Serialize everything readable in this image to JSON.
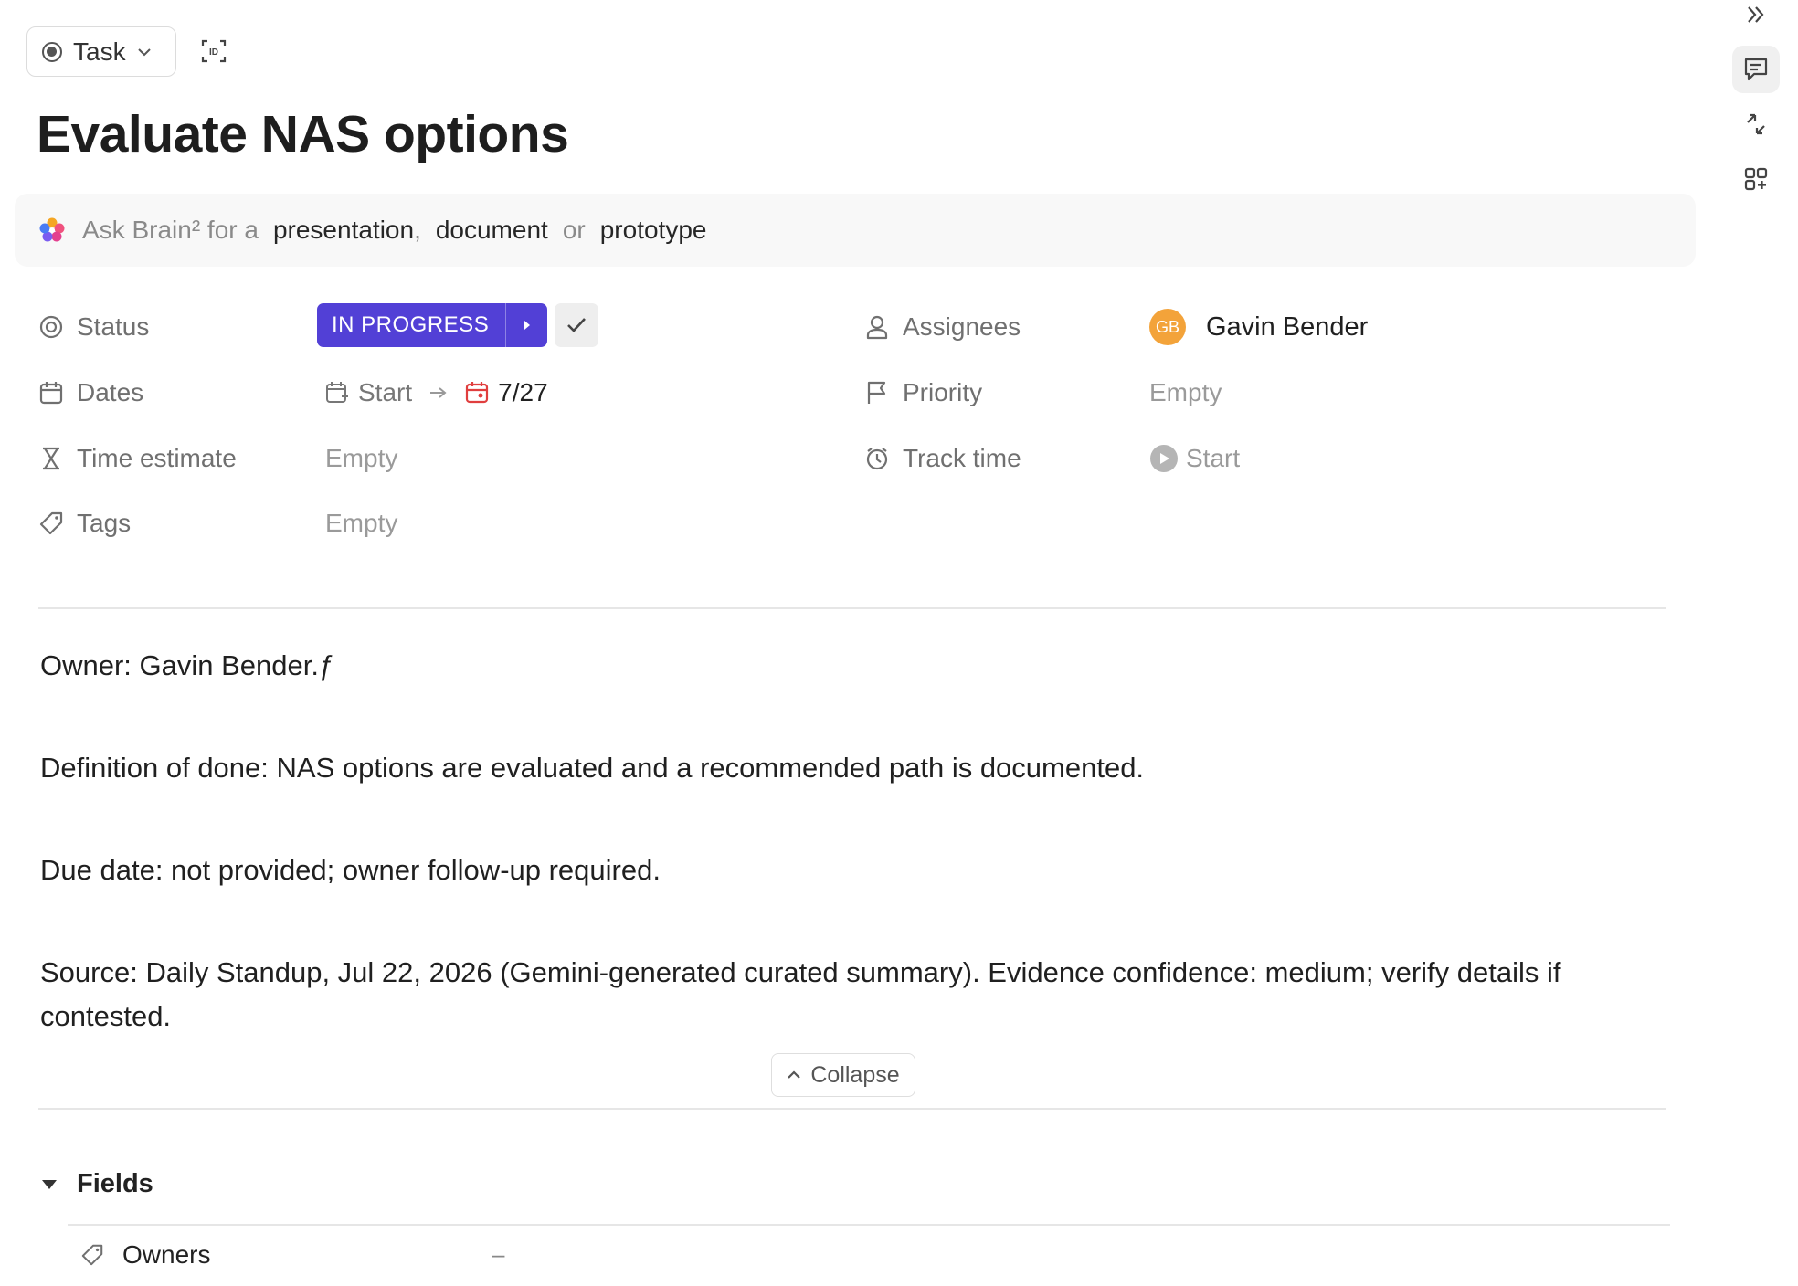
{
  "header": {
    "type_label": "Task",
    "title": "Evaluate NAS options"
  },
  "brain_bar": {
    "prefix": "Ask Brain² for a",
    "option_1": "presentation",
    "comma": ",",
    "option_2": "document",
    "or": "or",
    "option_3": "prototype"
  },
  "properties": {
    "status": {
      "label": "Status",
      "value": "IN PROGRESS",
      "color": "#5240d6"
    },
    "dates": {
      "label": "Dates",
      "start": "Start",
      "due": "7/27"
    },
    "time_estimate": {
      "label": "Time estimate",
      "value": "Empty"
    },
    "tags": {
      "label": "Tags",
      "value": "Empty"
    },
    "assignees": {
      "label": "Assignees",
      "avatar_initials": "GB",
      "name": "Gavin Bender"
    },
    "priority": {
      "label": "Priority",
      "value": "Empty"
    },
    "track_time": {
      "label": "Track time",
      "value": "Start"
    }
  },
  "description": {
    "owner": "Owner: Gavin Bender.ƒ",
    "definition": "Definition of done: NAS options are evaluated and a recommended path is documented.",
    "due": "Due date: not provided; owner follow-up required.",
    "source": "Source: Daily Standup, Jul 22, 2026 (Gemini-generated curated summary). Evidence confidence: medium; verify details if contested."
  },
  "collapse_label": "Collapse",
  "fields": {
    "header": "Fields",
    "rows": [
      {
        "label": "Owners",
        "value": "–"
      }
    ]
  },
  "sidebar_icons": [
    "double-chevron-right-icon",
    "comment-icon",
    "activity-icon",
    "apps-icon"
  ]
}
